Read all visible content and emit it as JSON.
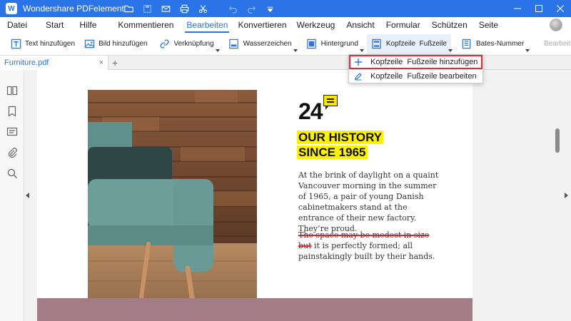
{
  "app": {
    "logo_letter": "W",
    "title": "Wondershare PDFelement"
  },
  "quick_access": [
    "folder-icon",
    "save-icon",
    "mail-icon",
    "print-icon",
    "scissors-icon",
    "undo-icon",
    "redo-icon",
    "dropdown-icon"
  ],
  "menu": {
    "items": [
      "Datei",
      "Start",
      "Hilfe",
      "Kommentieren",
      "Bearbeiten",
      "Konvertieren",
      "Werkzeug",
      "Ansicht",
      "Formular",
      "Schützen",
      "Seite"
    ],
    "active": "Bearbeiten"
  },
  "toolbar": {
    "text_add": "Text hinzufügen",
    "image_add": "Bild hinzufügen",
    "link": "Verknüpfung",
    "watermark": "Wasserzeichen",
    "background": "Hintergrund",
    "header_footer": "Kopfzeile  Fußzeile",
    "bates": "Bates-Nummer",
    "edit_toggle": "Bearbeiten"
  },
  "tabs": {
    "doc_name": "Furniture.pdf",
    "close": "×",
    "add": "+"
  },
  "dropdown": {
    "items": [
      {
        "label": "Kopfzeile  Fußzeile hinzufügen",
        "icon": "plus-icon",
        "highlighted": true
      },
      {
        "label": "Kopfzeile  Fußzeile bearbeiten",
        "icon": "pencil-icon",
        "highlighted": false
      }
    ]
  },
  "document": {
    "number": "24",
    "heading_line1": "OUR HISTORY",
    "heading_line2": "SINCE 1965",
    "paragraph1": "At the brink of daylight on a quaint Vancouver morning in the summer of 1965, a pair of young Danish cabinetmakers stand at the entrance of their new factory. They’re proud.",
    "paragraph2_struck": "The space may be modest in size but",
    "paragraph2_rest": " it is perfectly formed; all painstakingly built by their hands."
  },
  "colors": {
    "accent": "#2b74e8",
    "highlight": "#fff200",
    "strike": "#e0202a",
    "band": "#a47c86"
  }
}
